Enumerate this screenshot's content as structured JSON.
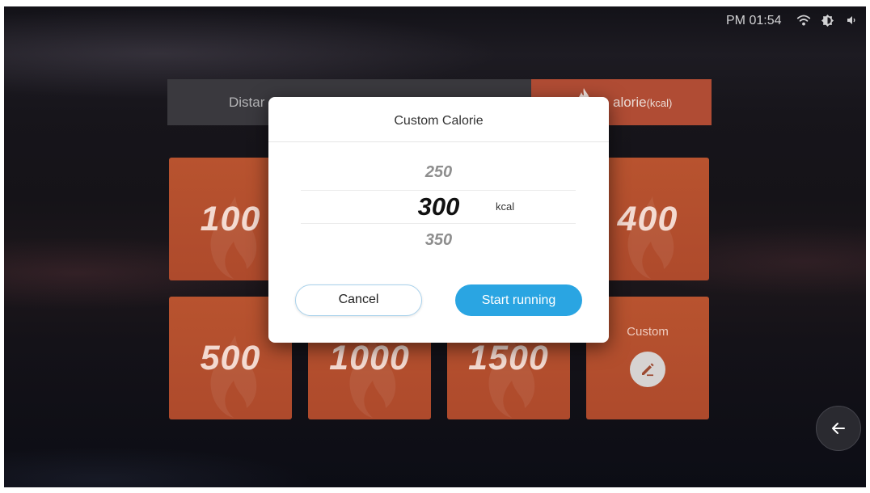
{
  "status_bar": {
    "time": "PM 01:54",
    "icons": [
      "wifi-icon",
      "brightness-icon",
      "volume-icon"
    ]
  },
  "tabs": [
    {
      "label": "Distar",
      "active": false
    },
    {
      "active": false
    },
    {
      "label": "alorie",
      "unit": "(kcal)",
      "icon": "flame-icon",
      "active": true
    }
  ],
  "tiles": [
    {
      "value": "100"
    },
    {},
    {},
    {
      "value": "400"
    },
    {
      "value": "500"
    },
    {
      "value": "1000"
    },
    {
      "value": "1500"
    },
    {
      "label": "Custom",
      "icon": "edit-icon"
    }
  ],
  "modal": {
    "title": "Custom Calorie",
    "picker": {
      "prev": "250",
      "selected": "300",
      "next": "350",
      "unit": "kcal"
    },
    "buttons": {
      "cancel": "Cancel",
      "confirm": "Start running"
    }
  },
  "back_button": {
    "icon": "arrow-left-icon"
  },
  "colors": {
    "tile": "#b8532f",
    "tab_active": "#b04c34",
    "tab_inactive": "#3a393e",
    "accent": "#2aa5e2",
    "accent_border": "#a9d2ec"
  }
}
